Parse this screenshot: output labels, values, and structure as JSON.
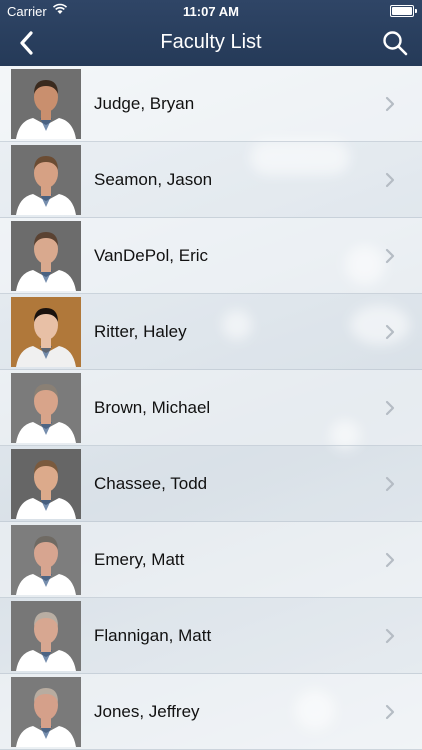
{
  "status_bar": {
    "carrier": "Carrier",
    "time": "11:07 AM"
  },
  "nav": {
    "title": "Faculty List"
  },
  "icons": {
    "back": "chevron-left-icon",
    "search": "search-icon",
    "row_arrow": "chevron-right-icon"
  },
  "colors": {
    "navbar": "#2b4060",
    "accent": "#ffffff"
  },
  "faculty": [
    {
      "name": "Judge, Bryan",
      "bg": "#6f6f6f",
      "hair": "#3a2a1e",
      "coat": "#ffffff",
      "skin": "#c98f6e"
    },
    {
      "name": "Seamon, Jason",
      "bg": "#707070",
      "hair": "#6b4c33",
      "coat": "#ffffff",
      "skin": "#d6a184"
    },
    {
      "name": "VanDePol, Eric",
      "bg": "#6c6c6c",
      "hair": "#5a4232",
      "coat": "#ffffff",
      "skin": "#d9a98e"
    },
    {
      "name": "Ritter, Haley",
      "bg": "#b0783a",
      "hair": "#1a120d",
      "coat": "#f0f0f0",
      "skin": "#e8c0a6"
    },
    {
      "name": "Brown, Michael",
      "bg": "#7b7b7b",
      "hair": "#8a8075",
      "coat": "#ffffff",
      "skin": "#d8a48a"
    },
    {
      "name": "Chassee, Todd",
      "bg": "#666666",
      "hair": "#7a5a3e",
      "coat": "#ffffff",
      "skin": "#dcaa8b"
    },
    {
      "name": "Emery, Matt",
      "bg": "#7d7d7d",
      "hair": "#6f6a63",
      "coat": "#ffffff",
      "skin": "#d7a590"
    },
    {
      "name": "Flannigan, Matt",
      "bg": "#777777",
      "hair": "#b9aea3",
      "coat": "#ffffff",
      "skin": "#d7a791"
    },
    {
      "name": "Jones, Jeffrey",
      "bg": "#7a7a7a",
      "hair": "#b8aca0",
      "coat": "#ffffff",
      "skin": "#d5a08a"
    }
  ]
}
